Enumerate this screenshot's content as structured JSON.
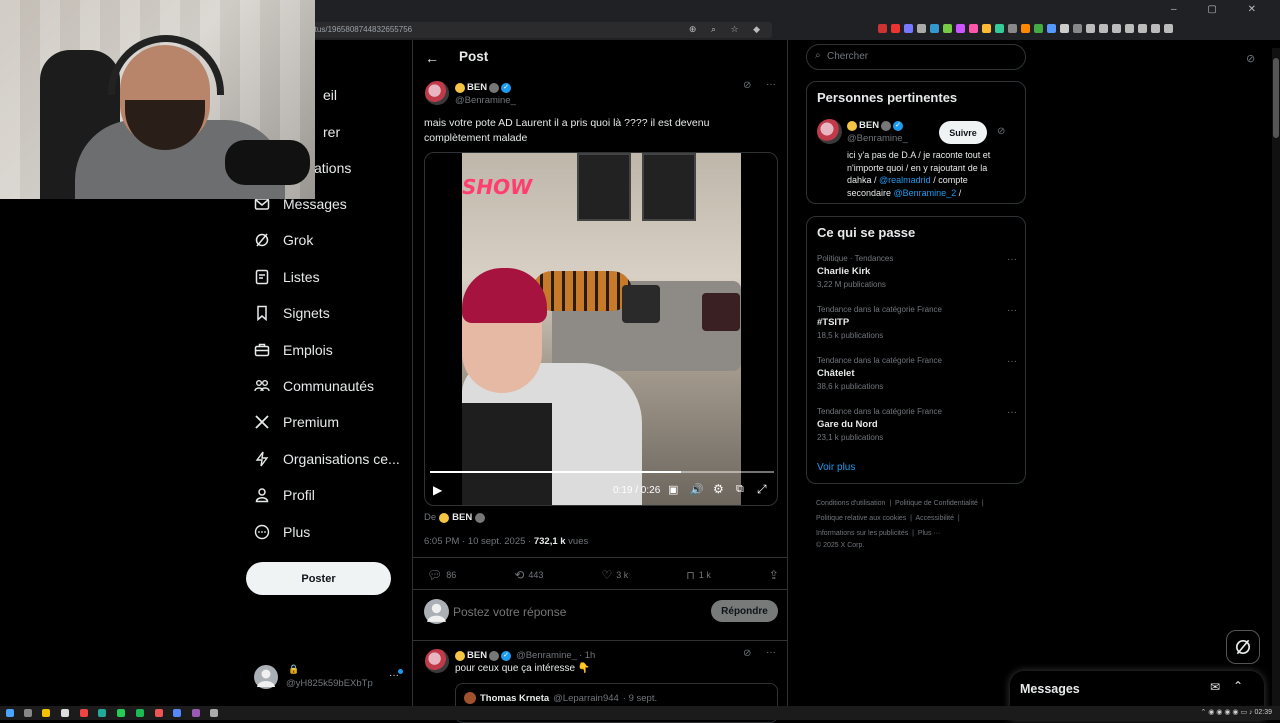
{
  "browser": {
    "url": "status/1965808744832655756",
    "window_controls": [
      "–",
      "▢",
      "✕"
    ]
  },
  "nav": {
    "items": [
      {
        "label": "Accueil",
        "visible_text": "eil",
        "icon": "home-icon"
      },
      {
        "label": "Explorer",
        "visible_text": "rer",
        "icon": "search-icon"
      },
      {
        "label": "Notifications",
        "visible_text": "cations",
        "icon": "bell-icon"
      },
      {
        "label": "Messages",
        "visible_text": "Messages",
        "icon": "mail-icon"
      },
      {
        "label": "Grok",
        "visible_text": "Grok",
        "icon": "grok-icon"
      },
      {
        "label": "Listes",
        "visible_text": "Listes",
        "icon": "list-icon"
      },
      {
        "label": "Signets",
        "visible_text": "Signets",
        "icon": "bookmark-icon"
      },
      {
        "label": "Emplois",
        "visible_text": "Emplois",
        "icon": "briefcase-icon"
      },
      {
        "label": "Communautés",
        "visible_text": "Communautés",
        "icon": "people-icon"
      },
      {
        "label": "Premium",
        "visible_text": "Premium",
        "icon": "x-logo-icon"
      },
      {
        "label": "Organisations ce...",
        "visible_text": "Organisations ce...",
        "icon": "lightning-icon"
      },
      {
        "label": "Profil",
        "visible_text": "Profil",
        "icon": "person-icon"
      },
      {
        "label": "Plus",
        "visible_text": "Plus",
        "icon": "more-circle-icon"
      }
    ],
    "post_button": "Poster",
    "account": {
      "lock": "🔒",
      "handle": "@yH825k59bEXbTp",
      "more": "···"
    }
  },
  "main": {
    "header_title": "Post",
    "tweet": {
      "name": "BEN",
      "handle": "@Benramine_",
      "text_line1": "mais votre pote AD Laurent il a pris quoi là ???? il est devenu",
      "text_line2": "complètement malade",
      "video": {
        "show_text": "SHOW",
        "time": "0:19 / 0:26",
        "progress_fraction": 0.73
      },
      "from_label": "De",
      "from_name": "BEN",
      "meta_time": "6:05 PM · 10 sept. 2025 · ",
      "views_count": "732,1 k",
      "views_label": " vues",
      "actions": {
        "replies": "86",
        "retweets": "443",
        "likes": "3 k",
        "bookmarks": "1 k"
      }
    },
    "reply_box": {
      "placeholder": "Postez votre réponse",
      "button": "Répondre"
    },
    "reply": {
      "name": "BEN",
      "handle": "@Benramine_",
      "time": "· 1h",
      "text": "pour ceux que ça intéresse 👇",
      "quoted_name": "Thomas Krneta",
      "quoted_handle": "@Leparrain944",
      "quoted_time": "· 9 sept."
    }
  },
  "right": {
    "search_placeholder": "Chercher",
    "relevant": {
      "title": "Personnes pertinentes",
      "name": "BEN",
      "handle": "@Benramine_",
      "follow": "Suivre",
      "bio_1": "ici y'a pas de D.A / je raconte tout et",
      "bio_2": "n'importe quoi / en y rajoutant de la",
      "bio_3a": "dahka / ",
      "bio_3b": "@realmadrid",
      "bio_3c": " / compte",
      "bio_4a": "secondaire ",
      "bio_4b": "@Benramine_2",
      "bio_4c": " /"
    },
    "trends": {
      "title": "Ce qui se passe",
      "items": [
        {
          "cat": "Politique · Tendances",
          "name": "Charlie Kirk",
          "count": "3,22 M publications"
        },
        {
          "cat": "Tendance dans la catégorie France",
          "name": "#TSITP",
          "count": "18,5 k publications"
        },
        {
          "cat": "Tendance dans la catégorie France",
          "name": "Châtelet",
          "count": "38,6 k publications"
        },
        {
          "cat": "Tendance dans la catégorie France",
          "name": "Gare du Nord",
          "count": "23,1 k publications"
        }
      ],
      "more": "Voir plus"
    },
    "footer": {
      "l1a": "Conditions d'utilisation",
      "l1b": "Politique de Confidentialité",
      "l2a": "Politique relative aux cookies",
      "l2b": "Accessibilité",
      "l3a": "Informations sur les publicités",
      "l3b": "Plus ···",
      "copyright": "© 2025 X Corp."
    },
    "messages_drawer": "Messages"
  },
  "taskbar": {
    "time": "02:39"
  },
  "colors": {
    "accent": "#1d9bf0",
    "background": "#000000",
    "border": "#2f3336",
    "muted": "#71767b"
  }
}
